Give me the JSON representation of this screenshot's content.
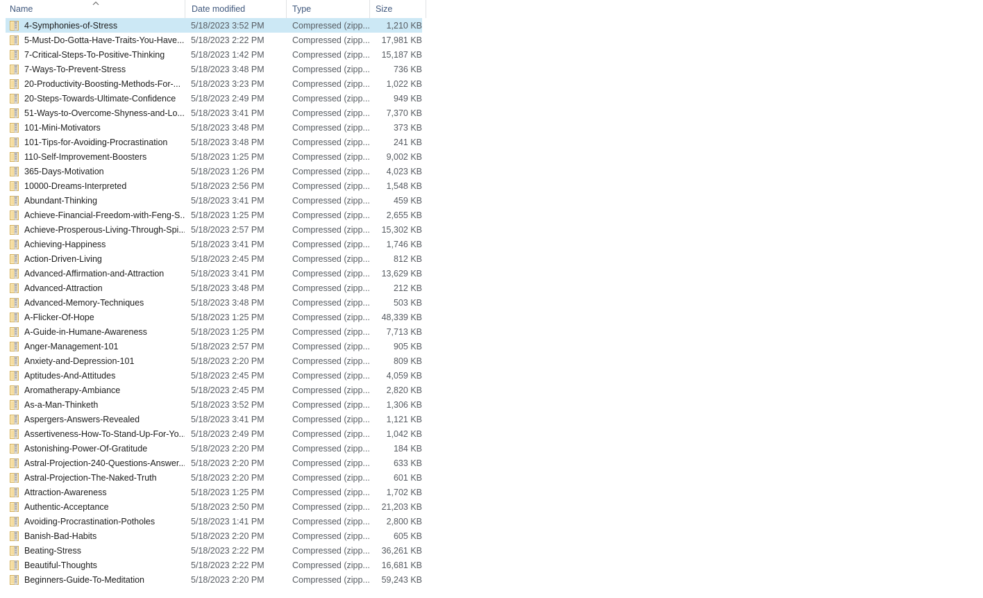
{
  "window": {
    "view_mode": "Details",
    "sort_column": "Name",
    "sort_direction": "ascending",
    "sort_indicator_icon": "chevron-up-icon"
  },
  "columns": [
    {
      "id": "name",
      "label": "Name"
    },
    {
      "id": "date",
      "label": "Date modified"
    },
    {
      "id": "type",
      "label": "Type"
    },
    {
      "id": "size",
      "label": "Size"
    }
  ],
  "colors": {
    "selection": "#cce8f5",
    "header_text": "#40587d",
    "row_text": "#1b1b1b",
    "secondary_text": "#555a60",
    "icon_body": "#f3d893",
    "icon_border": "#d9b357",
    "divider": "#e0e2e4"
  },
  "rows": [
    {
      "icon": "zip-file-icon",
      "name": "4-Symphonies-of-Stress",
      "date": "5/18/2023 3:52 PM",
      "type": "Compressed (zipp...",
      "size": "1,210 KB",
      "selected": true
    },
    {
      "icon": "zip-file-icon",
      "name": "5-Must-Do-Gotta-Have-Traits-You-Have...",
      "date": "5/18/2023 2:22 PM",
      "type": "Compressed (zipp...",
      "size": "17,981 KB",
      "selected": false
    },
    {
      "icon": "zip-file-icon",
      "name": "7-Critical-Steps-To-Positive-Thinking",
      "date": "5/18/2023 1:42 PM",
      "type": "Compressed (zipp...",
      "size": "15,187 KB",
      "selected": false
    },
    {
      "icon": "zip-file-icon",
      "name": "7-Ways-To-Prevent-Stress",
      "date": "5/18/2023 3:48 PM",
      "type": "Compressed (zipp...",
      "size": "736 KB",
      "selected": false
    },
    {
      "icon": "zip-file-icon",
      "name": "20-Productivity-Boosting-Methods-For-...",
      "date": "5/18/2023 3:23 PM",
      "type": "Compressed (zipp...",
      "size": "1,022 KB",
      "selected": false
    },
    {
      "icon": "zip-file-icon",
      "name": "20-Steps-Towards-Ultimate-Confidence",
      "date": "5/18/2023 2:49 PM",
      "type": "Compressed (zipp...",
      "size": "949 KB",
      "selected": false
    },
    {
      "icon": "zip-file-icon",
      "name": "51-Ways-to-Overcome-Shyness-and-Lo...",
      "date": "5/18/2023 3:41 PM",
      "type": "Compressed (zipp...",
      "size": "7,370 KB",
      "selected": false
    },
    {
      "icon": "zip-file-icon",
      "name": "101-Mini-Motivators",
      "date": "5/18/2023 3:48 PM",
      "type": "Compressed (zipp...",
      "size": "373 KB",
      "selected": false
    },
    {
      "icon": "zip-file-icon",
      "name": "101-Tips-for-Avoiding-Procrastination",
      "date": "5/18/2023 3:48 PM",
      "type": "Compressed (zipp...",
      "size": "241 KB",
      "selected": false
    },
    {
      "icon": "zip-file-icon",
      "name": "110-Self-Improvement-Boosters",
      "date": "5/18/2023 1:25 PM",
      "type": "Compressed (zipp...",
      "size": "9,002 KB",
      "selected": false
    },
    {
      "icon": "zip-file-icon",
      "name": "365-Days-Motivation",
      "date": "5/18/2023 1:26 PM",
      "type": "Compressed (zipp...",
      "size": "4,023 KB",
      "selected": false
    },
    {
      "icon": "zip-file-icon",
      "name": "10000-Dreams-Interpreted",
      "date": "5/18/2023 2:56 PM",
      "type": "Compressed (zipp...",
      "size": "1,548 KB",
      "selected": false
    },
    {
      "icon": "zip-file-icon",
      "name": "Abundant-Thinking",
      "date": "5/18/2023 3:41 PM",
      "type": "Compressed (zipp...",
      "size": "459 KB",
      "selected": false
    },
    {
      "icon": "zip-file-icon",
      "name": "Achieve-Financial-Freedom-with-Feng-S...",
      "date": "5/18/2023 1:25 PM",
      "type": "Compressed (zipp...",
      "size": "2,655 KB",
      "selected": false
    },
    {
      "icon": "zip-file-icon",
      "name": "Achieve-Prosperous-Living-Through-Spi...",
      "date": "5/18/2023 2:57 PM",
      "type": "Compressed (zipp...",
      "size": "15,302 KB",
      "selected": false
    },
    {
      "icon": "zip-file-icon",
      "name": "Achieving-Happiness",
      "date": "5/18/2023 3:41 PM",
      "type": "Compressed (zipp...",
      "size": "1,746 KB",
      "selected": false
    },
    {
      "icon": "zip-file-icon",
      "name": "Action-Driven-Living",
      "date": "5/18/2023 2:45 PM",
      "type": "Compressed (zipp...",
      "size": "812 KB",
      "selected": false
    },
    {
      "icon": "zip-file-icon",
      "name": "Advanced-Affirmation-and-Attraction",
      "date": "5/18/2023 3:41 PM",
      "type": "Compressed (zipp...",
      "size": "13,629 KB",
      "selected": false
    },
    {
      "icon": "zip-file-icon",
      "name": "Advanced-Attraction",
      "date": "5/18/2023 3:48 PM",
      "type": "Compressed (zipp...",
      "size": "212 KB",
      "selected": false
    },
    {
      "icon": "zip-file-icon",
      "name": "Advanced-Memory-Techniques",
      "date": "5/18/2023 3:48 PM",
      "type": "Compressed (zipp...",
      "size": "503 KB",
      "selected": false
    },
    {
      "icon": "zip-file-icon",
      "name": "A-Flicker-Of-Hope",
      "date": "5/18/2023 1:25 PM",
      "type": "Compressed (zipp...",
      "size": "48,339 KB",
      "selected": false
    },
    {
      "icon": "zip-file-icon",
      "name": "A-Guide-in-Humane-Awareness",
      "date": "5/18/2023 1:25 PM",
      "type": "Compressed (zipp...",
      "size": "7,713 KB",
      "selected": false
    },
    {
      "icon": "zip-file-icon",
      "name": "Anger-Management-101",
      "date": "5/18/2023 2:57 PM",
      "type": "Compressed (zipp...",
      "size": "905 KB",
      "selected": false
    },
    {
      "icon": "zip-file-icon",
      "name": "Anxiety-and-Depression-101",
      "date": "5/18/2023 2:20 PM",
      "type": "Compressed (zipp...",
      "size": "809 KB",
      "selected": false
    },
    {
      "icon": "zip-file-icon",
      "name": "Aptitudes-And-Attitudes",
      "date": "5/18/2023 2:45 PM",
      "type": "Compressed (zipp...",
      "size": "4,059 KB",
      "selected": false
    },
    {
      "icon": "zip-file-icon",
      "name": "Aromatherapy-Ambiance",
      "date": "5/18/2023 2:45 PM",
      "type": "Compressed (zipp...",
      "size": "2,820 KB",
      "selected": false
    },
    {
      "icon": "zip-file-icon",
      "name": "As-a-Man-Thinketh",
      "date": "5/18/2023 3:52 PM",
      "type": "Compressed (zipp...",
      "size": "1,306 KB",
      "selected": false
    },
    {
      "icon": "zip-file-icon",
      "name": "Aspergers-Answers-Revealed",
      "date": "5/18/2023 3:41 PM",
      "type": "Compressed (zipp...",
      "size": "1,121 KB",
      "selected": false
    },
    {
      "icon": "zip-file-icon",
      "name": "Assertiveness-How-To-Stand-Up-For-Yo...",
      "date": "5/18/2023 2:49 PM",
      "type": "Compressed (zipp...",
      "size": "1,042 KB",
      "selected": false
    },
    {
      "icon": "zip-file-icon",
      "name": "Astonishing-Power-Of-Gratitude",
      "date": "5/18/2023 2:20 PM",
      "type": "Compressed (zipp...",
      "size": "184 KB",
      "selected": false
    },
    {
      "icon": "zip-file-icon",
      "name": "Astral-Projection-240-Questions-Answer...",
      "date": "5/18/2023 2:20 PM",
      "type": "Compressed (zipp...",
      "size": "633 KB",
      "selected": false
    },
    {
      "icon": "zip-file-icon",
      "name": "Astral-Projection-The-Naked-Truth",
      "date": "5/18/2023 2:20 PM",
      "type": "Compressed (zipp...",
      "size": "601 KB",
      "selected": false
    },
    {
      "icon": "zip-file-icon",
      "name": "Attraction-Awareness",
      "date": "5/18/2023 1:25 PM",
      "type": "Compressed (zipp...",
      "size": "1,702 KB",
      "selected": false
    },
    {
      "icon": "zip-file-icon",
      "name": "Authentic-Acceptance",
      "date": "5/18/2023 2:50 PM",
      "type": "Compressed (zipp...",
      "size": "21,203 KB",
      "selected": false
    },
    {
      "icon": "zip-file-icon",
      "name": "Avoiding-Procrastination-Potholes",
      "date": "5/18/2023 1:41 PM",
      "type": "Compressed (zipp...",
      "size": "2,800 KB",
      "selected": false
    },
    {
      "icon": "zip-file-icon",
      "name": "Banish-Bad-Habits",
      "date": "5/18/2023 2:20 PM",
      "type": "Compressed (zipp...",
      "size": "605 KB",
      "selected": false
    },
    {
      "icon": "zip-file-icon",
      "name": "Beating-Stress",
      "date": "5/18/2023 2:22 PM",
      "type": "Compressed (zipp...",
      "size": "36,261 KB",
      "selected": false
    },
    {
      "icon": "zip-file-icon",
      "name": "Beautiful-Thoughts",
      "date": "5/18/2023 2:22 PM",
      "type": "Compressed (zipp...",
      "size": "16,681 KB",
      "selected": false
    },
    {
      "icon": "zip-file-icon",
      "name": "Beginners-Guide-To-Meditation",
      "date": "5/18/2023 2:20 PM",
      "type": "Compressed (zipp...",
      "size": "59,243 KB",
      "selected": false
    }
  ]
}
